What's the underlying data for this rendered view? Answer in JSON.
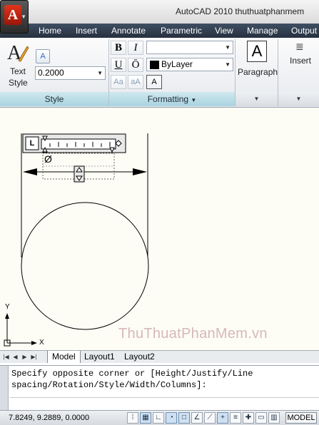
{
  "window": {
    "title": "AutoCAD 2010    thuthuatphanmem",
    "app_button_letter": "A"
  },
  "ribbon_tabs": [
    "Home",
    "Insert",
    "Annotate",
    "Parametric",
    "View",
    "Manage",
    "Output"
  ],
  "style_panel": {
    "text_style_label_1": "Text",
    "text_style_label_2": "Style",
    "height_value": "0.2000",
    "title": "Style"
  },
  "formatting_panel": {
    "bold": "B",
    "italic": "I",
    "underline": "U",
    "overline": "Ō",
    "uppercase": "Aa",
    "lowercase": "aA",
    "background_mask": "A",
    "font_value": "",
    "color_value": "ByLayer",
    "color_swatch": "#000000",
    "title": "Formatting"
  },
  "paragraph_panel": {
    "label": "Paragraph",
    "icon_letter": "A"
  },
  "insert_panel": {
    "label": "Insert"
  },
  "drawing": {
    "diameter_symbol": "Ø",
    "ucs_y": "Y",
    "ucs_x": "X",
    "ruler_L": "L"
  },
  "watermark": "ThuThuatPhanMem.vn",
  "layout_tabs": [
    {
      "label": "Model",
      "active": true
    },
    {
      "label": "Layout1",
      "active": false
    },
    {
      "label": "Layout2",
      "active": false
    }
  ],
  "command_line": {
    "line1": "Specify opposite corner or [Height/Justify/Line",
    "line2": "spacing/Rotation/Style/Width/Columns]:",
    "input": ""
  },
  "status_bar": {
    "coordinates": "7.8249, 9.2889, 0.0000",
    "model_label": "MODEL"
  },
  "colors": {
    "ribbon_tab_bg": "#2f3b4c",
    "panel_title_bg": "#b8dbe5",
    "drawing_bg": "#fdfcf5",
    "watermark": "#d6b9b6"
  }
}
